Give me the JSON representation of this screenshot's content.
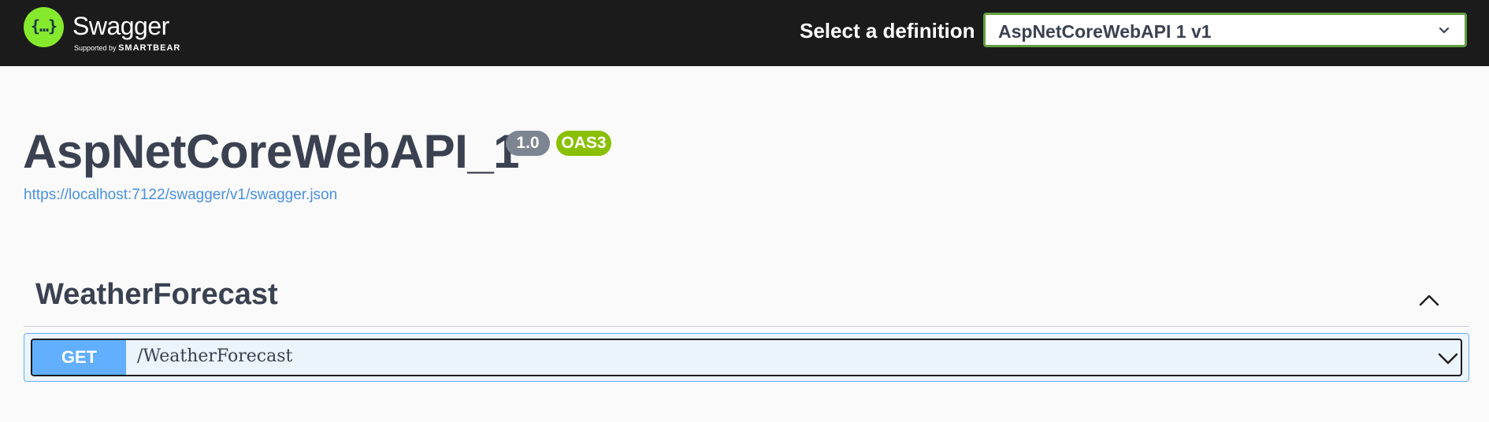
{
  "topbar": {
    "logo_icon": "swagger-braces-icon",
    "logo_glyph": "{…}",
    "brand": "Swagger",
    "supported_by": "Supported by",
    "supported_brand": "SMARTBEAR",
    "select_label": "Select a definition",
    "select_value": "AspNetCoreWebAPI 1 v1",
    "select_icon": "chevron-down-icon",
    "accent_color": "#85ea2d",
    "select_border_color": "#62a03f"
  },
  "info": {
    "title": "AspNetCoreWebAPI_1",
    "version_badge": "1.0",
    "oas_badge": "OAS3",
    "spec_url": "https://localhost:7122/swagger/v1/swagger.json",
    "version_badge_color": "#7d8492",
    "oas_badge_color": "#89bf04",
    "link_color": "#4990e2"
  },
  "tags": [
    {
      "name": "WeatherForecast",
      "toggle_icon": "chevron-up-icon",
      "operations": [
        {
          "method": "GET",
          "path": "/WeatherForecast",
          "expand_icon": "chevron-down-icon",
          "method_color": "#61affe",
          "background_color": "#ebf3fb"
        }
      ]
    }
  ]
}
